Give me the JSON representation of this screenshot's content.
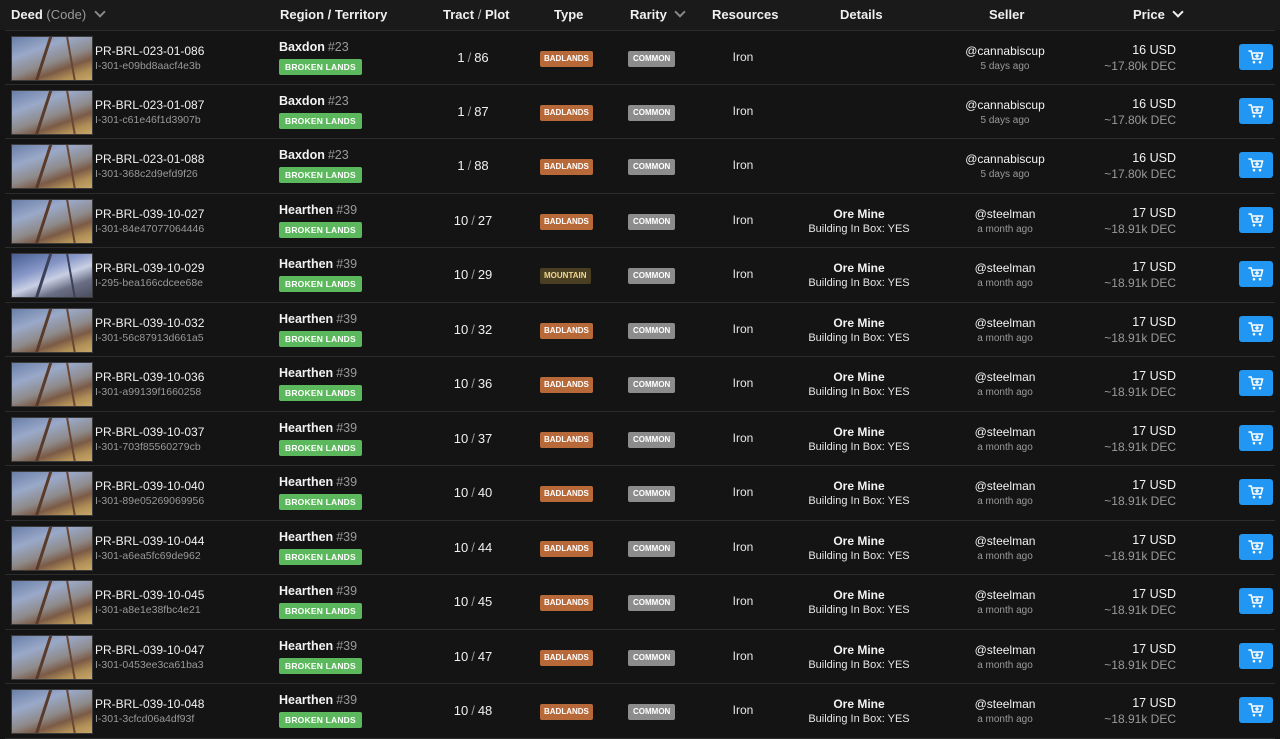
{
  "header": {
    "deed": "Deed",
    "deed_sub": "(Code)",
    "region": "Region / Territory",
    "tract": "Tract",
    "plot": "Plot",
    "type": "Type",
    "rarity": "Rarity",
    "resources": "Resources",
    "details": "Details",
    "seller": "Seller",
    "price": "Price"
  },
  "colors": {
    "badlands": "#b8693a",
    "mountain": "#4a3f22",
    "territory": "#5cb85c",
    "rarity": "#8c8c8c",
    "cart": "#2196f3"
  },
  "icons": {
    "sort": "chevron-down-icon",
    "buy": "shopping-cart-icon"
  },
  "rows": [
    {
      "code": "PR-BRL-023-01-086",
      "uid": "I-301-e09bd8aacf4e3b",
      "region": "Baxdon",
      "region_num": "#23",
      "territory": "BROKEN LANDS",
      "tract": "1",
      "plot": "86",
      "type": "BADLANDS",
      "rarity": "COMMON",
      "resource": "Iron",
      "detail": "",
      "detail_sub": "",
      "seller": "@cannabiscup",
      "ago": "5 days ago",
      "usd": "16 USD",
      "dec": "~17.80k DEC"
    },
    {
      "code": "PR-BRL-023-01-087",
      "uid": "I-301-c61e46f1d3907b",
      "region": "Baxdon",
      "region_num": "#23",
      "territory": "BROKEN LANDS",
      "tract": "1",
      "plot": "87",
      "type": "BADLANDS",
      "rarity": "COMMON",
      "resource": "Iron",
      "detail": "",
      "detail_sub": "",
      "seller": "@cannabiscup",
      "ago": "5 days ago",
      "usd": "16 USD",
      "dec": "~17.80k DEC"
    },
    {
      "code": "PR-BRL-023-01-088",
      "uid": "I-301-368c2d9efd9f26",
      "region": "Baxdon",
      "region_num": "#23",
      "territory": "BROKEN LANDS",
      "tract": "1",
      "plot": "88",
      "type": "BADLANDS",
      "rarity": "COMMON",
      "resource": "Iron",
      "detail": "",
      "detail_sub": "",
      "seller": "@cannabiscup",
      "ago": "5 days ago",
      "usd": "16 USD",
      "dec": "~17.80k DEC"
    },
    {
      "code": "PR-BRL-039-10-027",
      "uid": "I-301-84e47077064446",
      "region": "Hearthen",
      "region_num": "#39",
      "territory": "BROKEN LANDS",
      "tract": "10",
      "plot": "27",
      "type": "BADLANDS",
      "rarity": "COMMON",
      "resource": "Iron",
      "detail": "Ore Mine",
      "detail_sub": "Building In Box: YES",
      "seller": "@steelman",
      "ago": "a month ago",
      "usd": "17 USD",
      "dec": "~18.91k DEC"
    },
    {
      "code": "PR-BRL-039-10-029",
      "uid": "I-295-bea166cdcee68e",
      "region": "Hearthen",
      "region_num": "#39",
      "territory": "BROKEN LANDS",
      "tract": "10",
      "plot": "29",
      "type": "MOUNTAIN",
      "rarity": "COMMON",
      "resource": "Iron",
      "detail": "Ore Mine",
      "detail_sub": "Building In Box: YES",
      "seller": "@steelman",
      "ago": "a month ago",
      "usd": "17 USD",
      "dec": "~18.91k DEC"
    },
    {
      "code": "PR-BRL-039-10-032",
      "uid": "I-301-56c87913d661a5",
      "region": "Hearthen",
      "region_num": "#39",
      "territory": "BROKEN LANDS",
      "tract": "10",
      "plot": "32",
      "type": "BADLANDS",
      "rarity": "COMMON",
      "resource": "Iron",
      "detail": "Ore Mine",
      "detail_sub": "Building In Box: YES",
      "seller": "@steelman",
      "ago": "a month ago",
      "usd": "17 USD",
      "dec": "~18.91k DEC"
    },
    {
      "code": "PR-BRL-039-10-036",
      "uid": "I-301-a99139f1660258",
      "region": "Hearthen",
      "region_num": "#39",
      "territory": "BROKEN LANDS",
      "tract": "10",
      "plot": "36",
      "type": "BADLANDS",
      "rarity": "COMMON",
      "resource": "Iron",
      "detail": "Ore Mine",
      "detail_sub": "Building In Box: YES",
      "seller": "@steelman",
      "ago": "a month ago",
      "usd": "17 USD",
      "dec": "~18.91k DEC"
    },
    {
      "code": "PR-BRL-039-10-037",
      "uid": "I-301-703f85560279cb",
      "region": "Hearthen",
      "region_num": "#39",
      "territory": "BROKEN LANDS",
      "tract": "10",
      "plot": "37",
      "type": "BADLANDS",
      "rarity": "COMMON",
      "resource": "Iron",
      "detail": "Ore Mine",
      "detail_sub": "Building In Box: YES",
      "seller": "@steelman",
      "ago": "a month ago",
      "usd": "17 USD",
      "dec": "~18.91k DEC"
    },
    {
      "code": "PR-BRL-039-10-040",
      "uid": "I-301-89e05269069956",
      "region": "Hearthen",
      "region_num": "#39",
      "territory": "BROKEN LANDS",
      "tract": "10",
      "plot": "40",
      "type": "BADLANDS",
      "rarity": "COMMON",
      "resource": "Iron",
      "detail": "Ore Mine",
      "detail_sub": "Building In Box: YES",
      "seller": "@steelman",
      "ago": "a month ago",
      "usd": "17 USD",
      "dec": "~18.91k DEC"
    },
    {
      "code": "PR-BRL-039-10-044",
      "uid": "I-301-a6ea5fc69de962",
      "region": "Hearthen",
      "region_num": "#39",
      "territory": "BROKEN LANDS",
      "tract": "10",
      "plot": "44",
      "type": "BADLANDS",
      "rarity": "COMMON",
      "resource": "Iron",
      "detail": "Ore Mine",
      "detail_sub": "Building In Box: YES",
      "seller": "@steelman",
      "ago": "a month ago",
      "usd": "17 USD",
      "dec": "~18.91k DEC"
    },
    {
      "code": "PR-BRL-039-10-045",
      "uid": "I-301-a8e1e38fbc4e21",
      "region": "Hearthen",
      "region_num": "#39",
      "territory": "BROKEN LANDS",
      "tract": "10",
      "plot": "45",
      "type": "BADLANDS",
      "rarity": "COMMON",
      "resource": "Iron",
      "detail": "Ore Mine",
      "detail_sub": "Building In Box: YES",
      "seller": "@steelman",
      "ago": "a month ago",
      "usd": "17 USD",
      "dec": "~18.91k DEC"
    },
    {
      "code": "PR-BRL-039-10-047",
      "uid": "I-301-0453ee3ca61ba3",
      "region": "Hearthen",
      "region_num": "#39",
      "territory": "BROKEN LANDS",
      "tract": "10",
      "plot": "47",
      "type": "BADLANDS",
      "rarity": "COMMON",
      "resource": "Iron",
      "detail": "Ore Mine",
      "detail_sub": "Building In Box: YES",
      "seller": "@steelman",
      "ago": "a month ago",
      "usd": "17 USD",
      "dec": "~18.91k DEC"
    },
    {
      "code": "PR-BRL-039-10-048",
      "uid": "I-301-3cfcd06a4df93f",
      "region": "Hearthen",
      "region_num": "#39",
      "territory": "BROKEN LANDS",
      "tract": "10",
      "plot": "48",
      "type": "BADLANDS",
      "rarity": "COMMON",
      "resource": "Iron",
      "detail": "Ore Mine",
      "detail_sub": "Building In Box: YES",
      "seller": "@steelman",
      "ago": "a month ago",
      "usd": "17 USD",
      "dec": "~18.91k DEC"
    }
  ]
}
